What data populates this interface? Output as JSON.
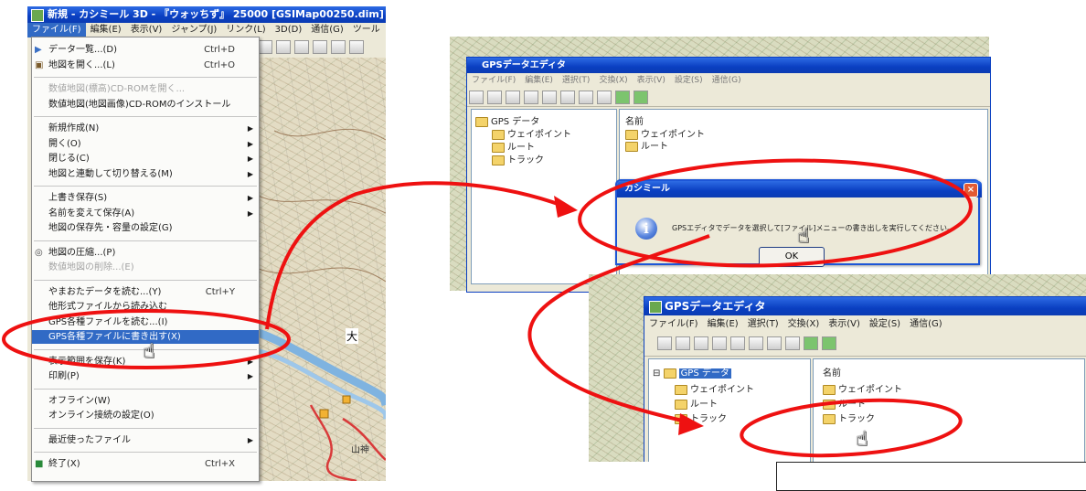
{
  "main_window": {
    "title": "新規 - カシミール 3D - 『ウォッちず』 25000 [GSIMap00250.dim]",
    "menus": [
      "ファイル(F)",
      "編集(E)",
      "表示(V)",
      "ジャンプ(J)",
      "リンク(L)",
      "3D(D)",
      "通信(G)",
      "ツール"
    ]
  },
  "file_menu": {
    "items": [
      {
        "label": "データ一覧...(D)",
        "shortcut": "Ctrl+D",
        "state": "normal"
      },
      {
        "label": "地図を開く...(L)",
        "shortcut": "Ctrl+O",
        "state": "normal"
      },
      {
        "label": "数値地図(標高)CD-ROMを開く...",
        "shortcut": "",
        "state": "disabled"
      },
      {
        "label": "数値地図(地図画像)CD-ROMのインストール",
        "shortcut": "",
        "state": "normal"
      },
      {
        "label": "新規作成(N)",
        "shortcut": "",
        "state": "submenu"
      },
      {
        "label": "開く(O)",
        "shortcut": "",
        "state": "submenu"
      },
      {
        "label": "閉じる(C)",
        "shortcut": "",
        "state": "submenu"
      },
      {
        "label": "地図と連動して切り替える(M)",
        "shortcut": "",
        "state": "submenu"
      },
      {
        "label": "上書き保存(S)",
        "shortcut": "",
        "state": "submenu"
      },
      {
        "label": "名前を変えて保存(A)",
        "shortcut": "",
        "state": "submenu"
      },
      {
        "label": "地図の保存先・容量の設定(G)",
        "shortcut": "",
        "state": "normal"
      },
      {
        "label": "地図の圧縮...(P)",
        "shortcut": "",
        "state": "normal"
      },
      {
        "label": "数値地図の削除...(E)",
        "shortcut": "",
        "state": "disabled"
      },
      {
        "label": "やまおたデータを読む...(Y)",
        "shortcut": "Ctrl+Y",
        "state": "normal"
      },
      {
        "label": "他形式ファイルから読み込む",
        "shortcut": "",
        "state": "normal"
      },
      {
        "label": "GPS各種ファイルを読む...(I)",
        "shortcut": "",
        "state": "normal"
      },
      {
        "label": "GPS各種ファイルに書き出す(X)",
        "shortcut": "",
        "state": "selected"
      },
      {
        "label": "表示範囲を保存(K)",
        "shortcut": "",
        "state": "submenu"
      },
      {
        "label": "印刷(P)",
        "shortcut": "",
        "state": "submenu"
      },
      {
        "label": "オフライン(W)",
        "shortcut": "",
        "state": "normal"
      },
      {
        "label": "オンライン接続の設定(O)",
        "shortcut": "",
        "state": "normal"
      },
      {
        "label": "最近使ったファイル",
        "shortcut": "",
        "state": "submenu"
      },
      {
        "label": "終了(X)",
        "shortcut": "Ctrl+X",
        "state": "normal"
      }
    ]
  },
  "gps_editor_top": {
    "title": "GPSデータエディタ",
    "menus": [
      "ファイル(F)",
      "編集(E)",
      "選択(T)",
      "交換(X)",
      "表示(V)",
      "設定(S)",
      "通信(G)"
    ],
    "tree": [
      "GPS データ",
      "ウェイポイント",
      "ルート",
      "トラック"
    ],
    "list_header": "名前",
    "list_items": [
      "ウェイポイント",
      "ルート"
    ]
  },
  "dialog": {
    "title": "カシミール",
    "message": "GPSエディタでデータを選択して[ファイル]メニューの書き出しを実行してください。",
    "ok_label": "OK"
  },
  "gps_editor_bottom": {
    "title": "GPSデータエディタ",
    "menus": [
      "ファイル(F)",
      "編集(E)",
      "選択(T)",
      "交換(X)",
      "表示(V)",
      "設定(S)",
      "通信(G)"
    ],
    "tree": [
      "GPS データ",
      "ウェイポイント",
      "ルート",
      "トラック"
    ],
    "list_header": "名前",
    "list_items": [
      "ウェイポイント",
      "ルート",
      "トラック"
    ]
  },
  "map_labels": [
    "大",
    "山神"
  ],
  "colors": {
    "annotation": "#ee1111",
    "selection": "#316ac5",
    "titlebar": "#0a3fc1"
  }
}
